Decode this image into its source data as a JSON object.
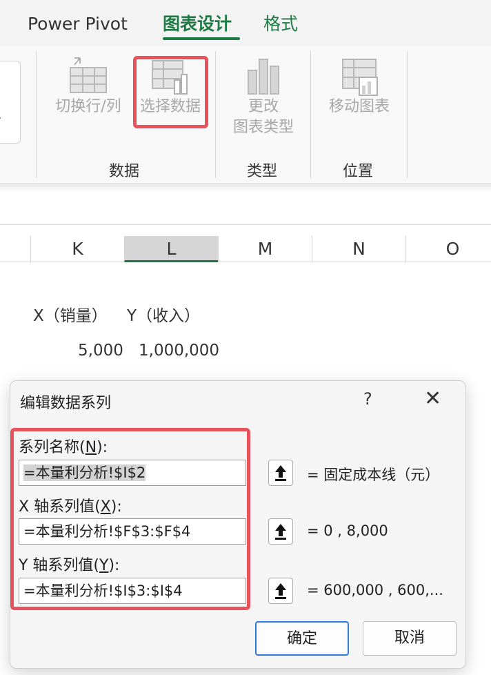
{
  "ribbon": {
    "tabs": {
      "power_pivot": "Power Pivot",
      "chart_design": "图表设计",
      "format": "格式"
    },
    "buttons": {
      "switch_row_col": "切换行/列",
      "select_data": "选择数据",
      "change_type_line1": "更改",
      "change_type_line2": "图表类型",
      "move_chart": "移动图表"
    },
    "groups": {
      "data": "数据",
      "type": "类型",
      "location": "位置"
    },
    "accent_color": "#1e7a44",
    "highlight_color": "#e8535b"
  },
  "sheet": {
    "columns": [
      "K",
      "L",
      "M",
      "N",
      "O"
    ],
    "selected_column": "L",
    "header_x": "X（销量）",
    "header_y": "Y（收入）",
    "value_x": "5,000",
    "value_y": "1,000,000"
  },
  "dialog": {
    "title": "编辑数据系列",
    "help": "?",
    "close": "✕",
    "series_name": {
      "label_prefix": "系列名称(",
      "label_key": "N",
      "label_suffix": "):",
      "value": "=本量利分析!$I$2",
      "preview": "= 固定成本线（元）"
    },
    "x_values": {
      "label_prefix": "X 轴系列值(",
      "label_key": "X",
      "label_suffix": "):",
      "value": "=本量利分析!$F$3:$F$4",
      "preview": "= 0 , 8,000"
    },
    "y_values": {
      "label_prefix": "Y 轴系列值(",
      "label_key": "Y",
      "label_suffix": "):",
      "value": "=本量利分析!$I$3:$I$4",
      "preview": "= 600,000 , 600,..."
    },
    "ok": "确定",
    "cancel": "取消"
  }
}
